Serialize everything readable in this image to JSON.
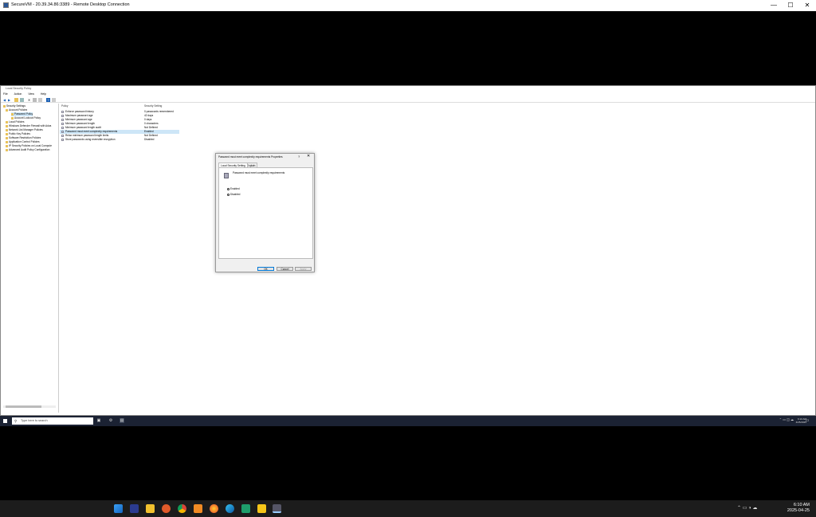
{
  "rdp": {
    "title": "SecureVM - 20.39.34.86:3389 - Remote Desktop Connection",
    "min": "—",
    "max": "☐",
    "close": "✕"
  },
  "lsp": {
    "title": "Local Security Policy",
    "menu": [
      "File",
      "Action",
      "View",
      "Help"
    ],
    "tree": [
      {
        "label": "Security Settings"
      },
      {
        "label": "Account Policies"
      },
      {
        "label": "Password Policy"
      },
      {
        "label": "Account Lockout Policy"
      },
      {
        "label": "Local Policies"
      },
      {
        "label": "Windows Defender Firewall with Adva"
      },
      {
        "label": "Network List Manager Policies"
      },
      {
        "label": "Public Key Policies"
      },
      {
        "label": "Software Restriction Policies"
      },
      {
        "label": "Application Control Policies"
      },
      {
        "label": "IP Security Policies on Local Compute"
      },
      {
        "label": "Advanced Audit Policy Configuration"
      }
    ],
    "columns": {
      "policy": "Policy",
      "setting": "Security Setting"
    },
    "rows": [
      {
        "policy": "Enforce password history",
        "setting": "0 passwords remembered"
      },
      {
        "policy": "Maximum password age",
        "setting": "42 days"
      },
      {
        "policy": "Minimum password age",
        "setting": "0 days"
      },
      {
        "policy": "Minimum password length",
        "setting": "0 characters"
      },
      {
        "policy": "Minimum password length audit",
        "setting": "Not Defined"
      },
      {
        "policy": "Password must meet complexity requirements",
        "setting": "Enabled"
      },
      {
        "policy": "Relax minimum password length limits",
        "setting": "Not Defined"
      },
      {
        "policy": "Store passwords using reversible encryption",
        "setting": "Disabled"
      }
    ]
  },
  "dialog": {
    "title": "Password must meet complexity requirements Properties",
    "help": "?",
    "close": "✕",
    "tabs": [
      "Local Security Setting",
      "Explain"
    ],
    "policy_label": "Password must meet complexity requirements",
    "enabled": "Enabled",
    "disabled": "Disabled",
    "selected": "Enabled",
    "ok": "OK",
    "cancel": "Cancel",
    "apply": "Apply"
  },
  "vm_taskbar": {
    "search_placeholder": "Type here to search",
    "time": "6:10 AM",
    "date": "4/25/2025"
  },
  "host_taskbar": {
    "time": "6:10 AM",
    "date": "2025-04-25"
  },
  "colors": {
    "selection": "#cde6f7",
    "vm_taskbar": "#1b2233",
    "host_taskbar": "#1c1c1c"
  }
}
